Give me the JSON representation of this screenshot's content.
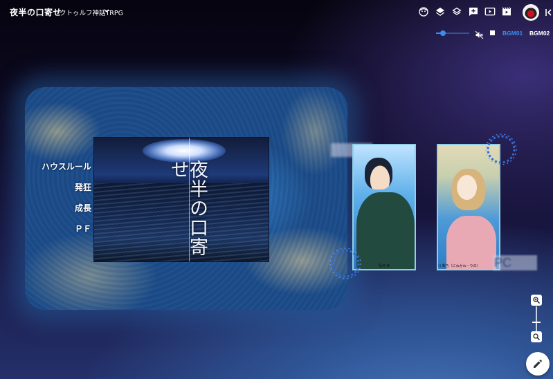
{
  "header": {
    "room_title": "夜半の口寄せ",
    "system": "クトゥルフ神話TRPG"
  },
  "toolbar": {
    "icons": [
      "face-icon",
      "layers-icon",
      "layers-outline-icon",
      "add-comment-icon",
      "play-screen-icon",
      "movie-icon",
      "user-avatar",
      "collapse-icon"
    ]
  },
  "bgm": {
    "volume": 0.2,
    "tracks": [
      "BGM01",
      "BGM02"
    ],
    "active_track": "BGM01",
    "active_color": "#3b8bf0"
  },
  "stage": {
    "menu": [
      "ハウスルール",
      "発狂",
      "成長",
      "ＰＦ"
    ],
    "title_card": "夜半の口寄せ"
  },
  "tokens": [
    {
      "name": "保河 柊",
      "label": "保河 柊"
    },
    {
      "name": "庭川 梨乃",
      "label": "庭川 梨乃（にわかわ・りの）"
    }
  ],
  "labels": {
    "pc": "PC",
    "kpc": "KPC"
  },
  "zoom": {
    "level": 0.35
  },
  "colors": {
    "accent": "#3b8bf0",
    "background_top": "#06040f",
    "background_bottom": "#24306a"
  }
}
